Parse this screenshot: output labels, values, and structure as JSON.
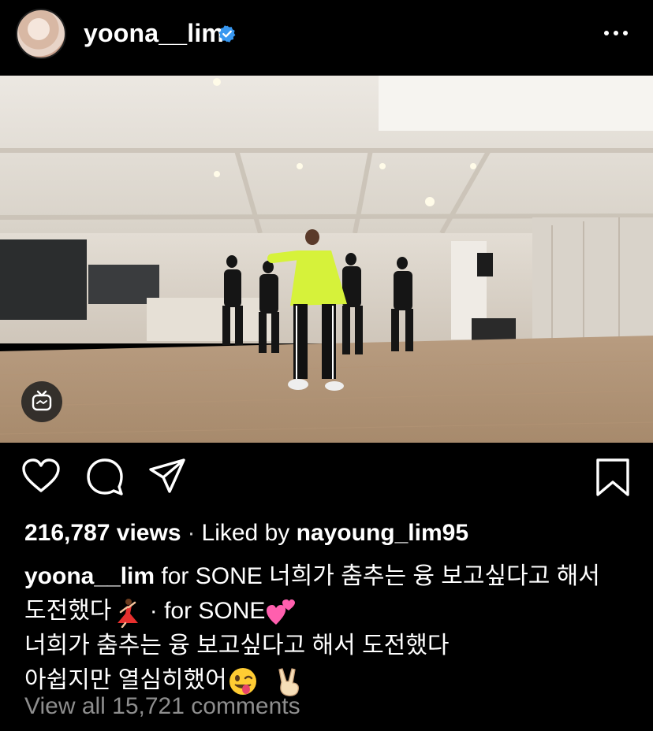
{
  "post": {
    "username": "yoona__lim",
    "verified": true,
    "more_icon": "more-horizontal-icon"
  },
  "media": {
    "type": "igtv-video",
    "badge_icon": "igtv-icon"
  },
  "actions": {
    "like_icon": "heart-icon",
    "comment_icon": "comment-icon",
    "share_icon": "send-icon",
    "save_icon": "bookmark-icon"
  },
  "stats": {
    "views": "216,787 views",
    "separator": "·",
    "liked_by_prefix": "Liked by",
    "liked_by_user": "nayoung_lim95"
  },
  "caption": {
    "author": "yoona__lim",
    "line1_rest": "for SONE  너희가 춤추는 융 보고싶다고 해서",
    "line2_text": "도전했다",
    "line2_emoji": "dancer-emoji",
    "line2_rest": "· for SONE",
    "line2_emoji2": "two-hearts-emoji",
    "line3": "너희가 춤추는 융 보고싶다고 해서 도전했다",
    "line4_text": "아쉽지만 열심히했어",
    "line4_emoji1": "winking-tongue-emoji",
    "line4_emoji2": "victory-hand-emoji"
  },
  "comments": {
    "view_all": "View all 15,721 comments"
  },
  "colors": {
    "background": "#000000",
    "verified_blue": "#3897f0",
    "muted_text": "#8e8e8e"
  }
}
